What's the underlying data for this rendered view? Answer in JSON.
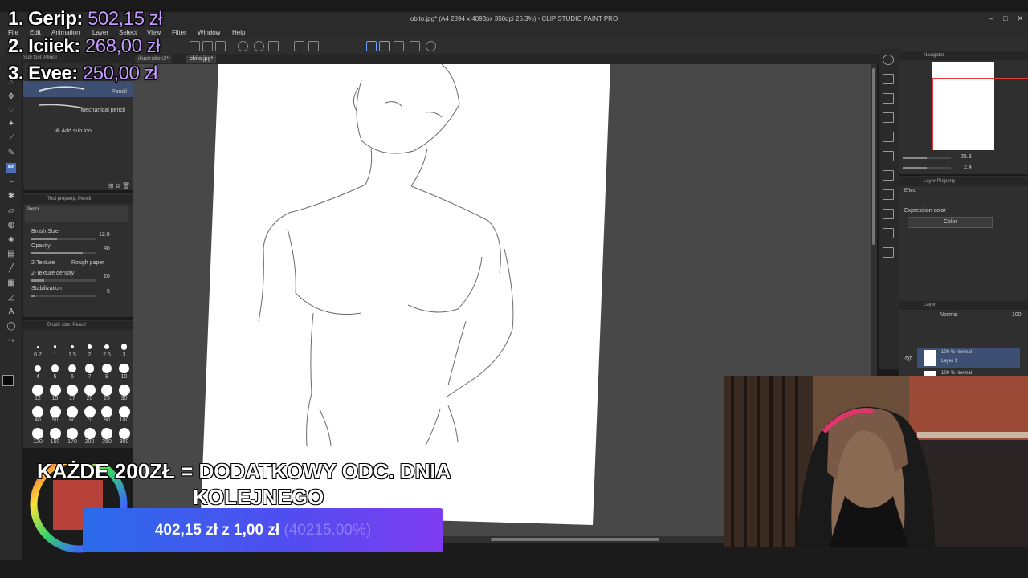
{
  "window": {
    "title": "obito.jpg* (A4 2894 x 4093px 350dpi 25.3%) - CLIP STUDIO PAINT PRO"
  },
  "menu": [
    "File",
    "Edit",
    "Animation",
    "Layer",
    "Select",
    "View",
    "Filter",
    "Window",
    "Help"
  ],
  "tabs": [
    "illustration2*",
    "obito.jpg*"
  ],
  "subtool": {
    "header": "Sub tool: Pencil",
    "items": [
      "Pencil",
      "Mechanical pencil"
    ],
    "add_label": "Add sub tool"
  },
  "tool_property": {
    "header": "Tool property: Pencil",
    "preview_label": "Pencil",
    "brush_size_label": "Brush Size",
    "brush_size_value": "12.0",
    "opacity_label": "Opacity",
    "opacity_value": "80",
    "texture_label": "2-Texture",
    "texture_value": "Rough paper",
    "texture_density_label": "2-Texture density",
    "texture_density_value": "20",
    "stabilization_label": "Stabilization",
    "stabilization_value": "5"
  },
  "brush_size_panel": {
    "header": "Brush size: Pencil",
    "sizes": [
      "0.7",
      "1",
      "1.5",
      "2",
      "2.5",
      "3",
      "4",
      "5",
      "6",
      "7",
      "8",
      "10",
      "12",
      "15",
      "17",
      "20",
      "25",
      "30",
      "40",
      "50",
      "60",
      "70",
      "80",
      "100",
      "120",
      "150",
      "170",
      "200",
      "250",
      "300"
    ]
  },
  "navigator": {
    "header": "Navigator",
    "zoom": "25.3",
    "angle": "2.4"
  },
  "layer_property": {
    "header": "Layer Property",
    "effect_label": "Effect",
    "expression_label": "Expression color",
    "expression_value": "Color"
  },
  "layers": {
    "header": "Layer",
    "blend_mode": "Normal",
    "opacity": "100",
    "items": [
      {
        "meta": "100 % Normal",
        "name": "Layer 1"
      },
      {
        "meta": "100 % Normal",
        "name": ""
      }
    ]
  },
  "leaderboard": [
    {
      "rank": "1. Gerip:",
      "amount": "502,15 zł"
    },
    {
      "rank": "2. Iciiek:",
      "amount": "268,00 zł"
    },
    {
      "rank": "3. Evee:",
      "amount": "250,00 zł"
    }
  ],
  "goal": {
    "line1": "KAŻDE 200ZŁ = DODATKOWY ODC. DNIA",
    "line2": "KOLEJNEGO",
    "progress_text": "402,15 zł z 1,00 zł",
    "progress_percent": "(40215.00%)"
  },
  "colors": {
    "accent_purple": "#c59bff",
    "progress_start": "#2a6bea",
    "progress_end": "#7f3cf0"
  }
}
